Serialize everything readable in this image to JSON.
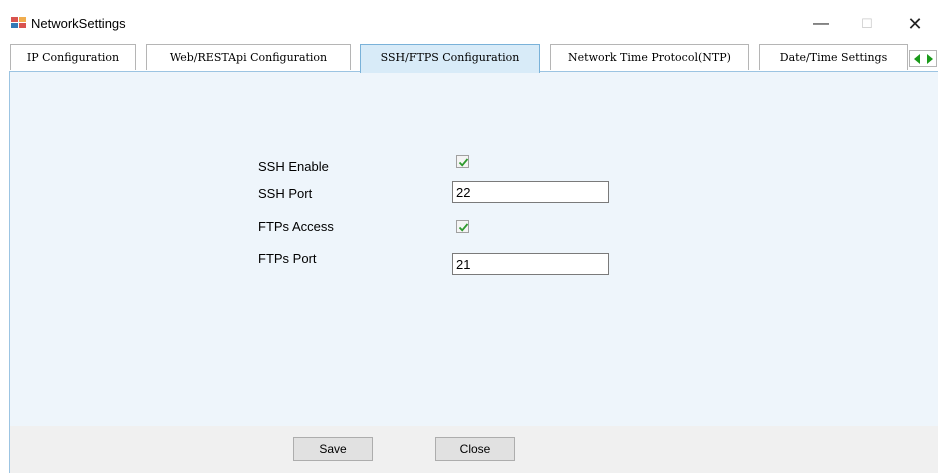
{
  "window": {
    "title": "NetworkSettings",
    "minimize_glyph": "—",
    "maximize_glyph": "☐",
    "close_glyph": "✕"
  },
  "tabs": [
    {
      "label": "IP Configuration",
      "active": false
    },
    {
      "label": "Web/RESTApi Configuration",
      "active": false
    },
    {
      "label": "SSH/FTPS Configuration",
      "active": true
    },
    {
      "label": "Network Time Protocol(NTP)",
      "active": false
    },
    {
      "label": "Date/Time Settings",
      "active": false
    }
  ],
  "form": {
    "ssh_enable_label": "SSH Enable",
    "ssh_enable_checked": true,
    "ssh_port_label": "SSH Port",
    "ssh_port_value": "22",
    "ftps_access_label": "FTPs Access",
    "ftps_access_checked": true,
    "ftps_port_label": "FTPs Port",
    "ftps_port_value": "21"
  },
  "buttons": {
    "save_label": "Save",
    "close_label": "Close"
  },
  "colors": {
    "active_tab": "#d8ebf8",
    "panel": "#eef5fb",
    "check_green": "#2e9a2e"
  }
}
